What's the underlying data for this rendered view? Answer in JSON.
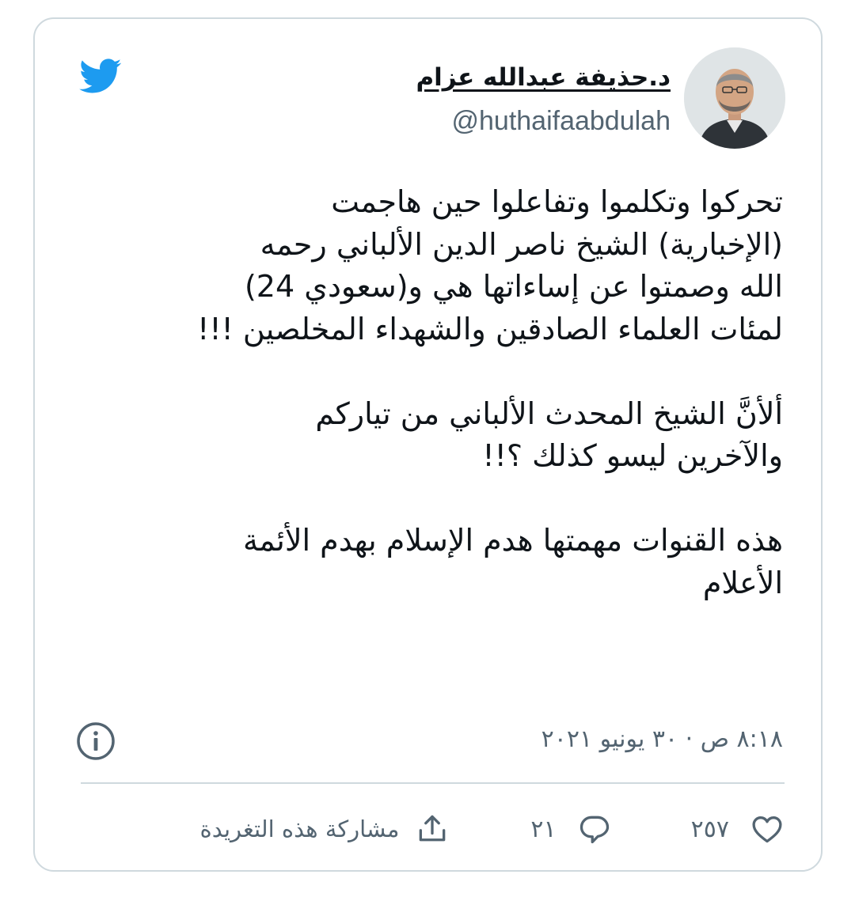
{
  "author": {
    "display_name": "د.حذيفة عبدالله عزام",
    "handle": "@huthaifaabdulah",
    "avatar_icon": "profile-photo"
  },
  "tweet": {
    "paragraphs": [
      [
        "تحركوا وتكلموا وتفاعلوا حين هاجمت",
        "(الإخبارية) الشيخ ناصر الدين الألباني رحمه",
        "الله وصمتوا عن إساءاتها هي و(سعودي 24)",
        "لمئات العلماء الصادقين والشهداء المخلصين !!!"
      ],
      [
        "ألأنَّ الشيخ المحدث الألباني من تياركم",
        "والآخرين ليسو كذلك ؟!!"
      ],
      [
        "هذه القنوات مهمتها هدم الإسلام بهدم الأئمة",
        "الأعلام"
      ]
    ],
    "timestamp": "٨:١٨ ص · ٣٠ يونيو ٢٠٢١"
  },
  "actions": {
    "likes_count": "٢٥٧",
    "replies_count": "٢١",
    "share_label": "مشاركة هذه التغريدة"
  },
  "colors": {
    "brand": "#1d9bf0",
    "border": "#cfd9de",
    "text_primary": "#0f1419",
    "text_secondary": "#536471"
  }
}
